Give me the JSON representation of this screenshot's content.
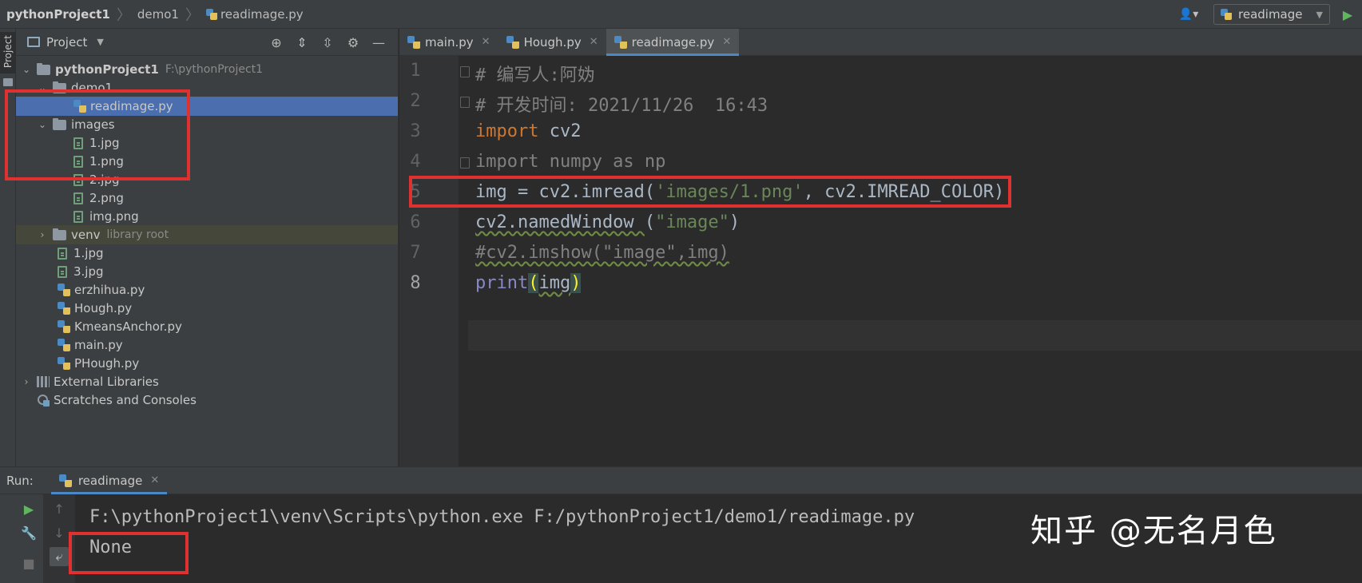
{
  "navbar": {
    "project": "pythonProject1",
    "folder": "demo1",
    "file": "readimage.py",
    "run_config": "readimage"
  },
  "left_strip": {
    "project_tab": "Project"
  },
  "project_panel": {
    "title": "Project",
    "tree": [
      {
        "label": "pythonProject1",
        "path": "F:\\pythonProject1"
      },
      {
        "label": "demo1"
      },
      {
        "label": "readimage.py"
      },
      {
        "label": "images"
      },
      {
        "label": "1.jpg"
      },
      {
        "label": "1.png"
      },
      {
        "label": "2.jpg"
      },
      {
        "label": "2.png"
      },
      {
        "label": "img.png"
      },
      {
        "label": "venv",
        "note": "library root"
      },
      {
        "label": "1.jpg"
      },
      {
        "label": "3.jpg"
      },
      {
        "label": "erzhihua.py"
      },
      {
        "label": "Hough.py"
      },
      {
        "label": "KmeansAnchor.py"
      },
      {
        "label": "main.py"
      },
      {
        "label": "PHough.py"
      },
      {
        "label": "External Libraries"
      },
      {
        "label": "Scratches and Consoles"
      }
    ]
  },
  "editor": {
    "tabs": [
      {
        "label": "main.py"
      },
      {
        "label": "Hough.py"
      },
      {
        "label": "readimage.py"
      }
    ],
    "line_numbers": [
      "1",
      "2",
      "3",
      "4",
      "5",
      "6",
      "7",
      "8"
    ],
    "code": {
      "l1": "# 编写人:阿妫",
      "l2": "# 开发时间: 2021/11/26  16:43",
      "l3_kw": "import",
      "l3_rest": " cv2",
      "l4": "import numpy as np",
      "l5_a": "img = cv2.imread(",
      "l5_str": "'images/1.png'",
      "l5_b": ", cv2.IMREAD_COLOR)",
      "l6_a": "cv2.namedWindow ",
      "l6_b": "(",
      "l6_str": "\"image\"",
      "l6_c": ")",
      "l7": "#cv2.imshow(\"image\",img)",
      "l8_fn": "print",
      "l8_open": "(",
      "l8_arg": "img",
      "l8_close": ")"
    }
  },
  "run_panel": {
    "label": "Run:",
    "tab": "readimage",
    "output": [
      "F:\\pythonProject1\\venv\\Scripts\\python.exe F:/pythonProject1/demo1/readimage.py",
      "None"
    ]
  },
  "watermark": "知乎 @无名月色"
}
